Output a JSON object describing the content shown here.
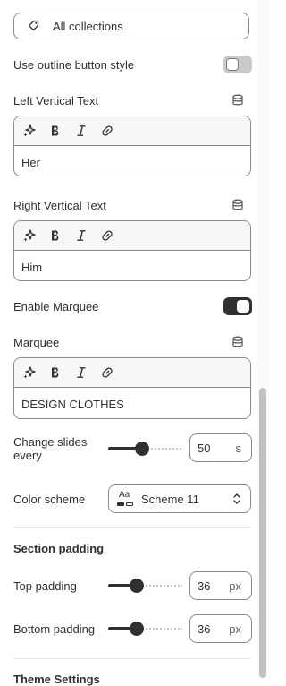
{
  "collections_button": {
    "label": "All collections",
    "icon": "tag-icon"
  },
  "outline_button": {
    "label": "Use outline button style",
    "enabled": false
  },
  "left_vertical_text": {
    "label": "Left Vertical Text",
    "value": "Her"
  },
  "right_vertical_text": {
    "label": "Right Vertical Text",
    "value": "Him"
  },
  "enable_marquee": {
    "label": "Enable Marquee",
    "enabled": true
  },
  "marquee": {
    "label": "Marquee",
    "value": "DESIGN CLOTHES"
  },
  "change_slides": {
    "label_line1": "Change slides",
    "label_line2": "every",
    "value": "50",
    "unit": "s",
    "fraction": 0.45
  },
  "color_scheme": {
    "label": "Color scheme",
    "value": "Scheme 11",
    "swatch_text": "Aa"
  },
  "section_padding": {
    "heading": "Section padding",
    "top": {
      "label": "Top padding",
      "value": "36",
      "unit": "px",
      "fraction": 0.36
    },
    "bottom": {
      "label": "Bottom padding",
      "value": "36",
      "unit": "px",
      "fraction": 0.36
    }
  },
  "next_section": {
    "heading": "Theme Settings"
  },
  "icons": {
    "dynamic_source": "database-icon",
    "ai": "sparkle-icon",
    "bold": "bold-icon",
    "italic": "italic-icon",
    "link": "link-icon",
    "chevron": "chevron-up-down-icon"
  },
  "colors": {
    "accent": "#303030",
    "border": "#8a8a8a",
    "toggle_off": "#c9c9c9"
  }
}
